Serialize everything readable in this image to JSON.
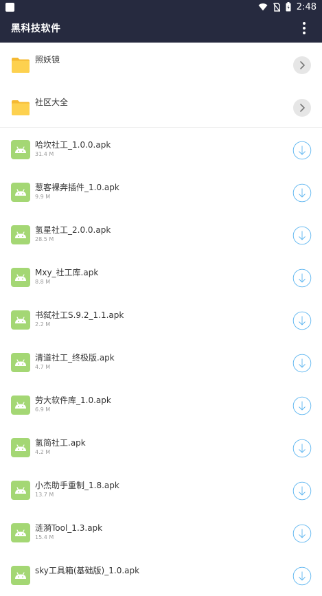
{
  "status": {
    "time": "2:48"
  },
  "app": {
    "title": "黑科技软件"
  },
  "folders": [
    {
      "name": "照妖镜"
    },
    {
      "name": "社区大全"
    }
  ],
  "files": [
    {
      "name": "哈坎社工_1.0.0.apk",
      "size": "31.4 M"
    },
    {
      "name": "葱客裸奔插件_1.0.apk",
      "size": "9.9 M"
    },
    {
      "name": "氢星社工_2.0.0.apk",
      "size": "28.5 M"
    },
    {
      "name": "Mxy_社工库.apk",
      "size": "8.8 M"
    },
    {
      "name": "书弑社工S.9.2_1.1.apk",
      "size": "2.2 M"
    },
    {
      "name": "清道社工_终极版.apk",
      "size": "4.7 M"
    },
    {
      "name": "劳大软件库_1.0.apk",
      "size": "6.9 M"
    },
    {
      "name": "氢简社工.apk",
      "size": "4.2 M"
    },
    {
      "name": "小杰助手重制_1.8.apk",
      "size": "13.7 M"
    },
    {
      "name": "涟漪Tool_1.3.apk",
      "size": "15.4 M"
    },
    {
      "name": "sky工具箱(基础版)_1.0.apk",
      "size": ""
    }
  ],
  "colors": {
    "bar": "#262a3f",
    "folder": "#fdd14f",
    "android": "#a4d774",
    "download": "#5ab4f0"
  }
}
